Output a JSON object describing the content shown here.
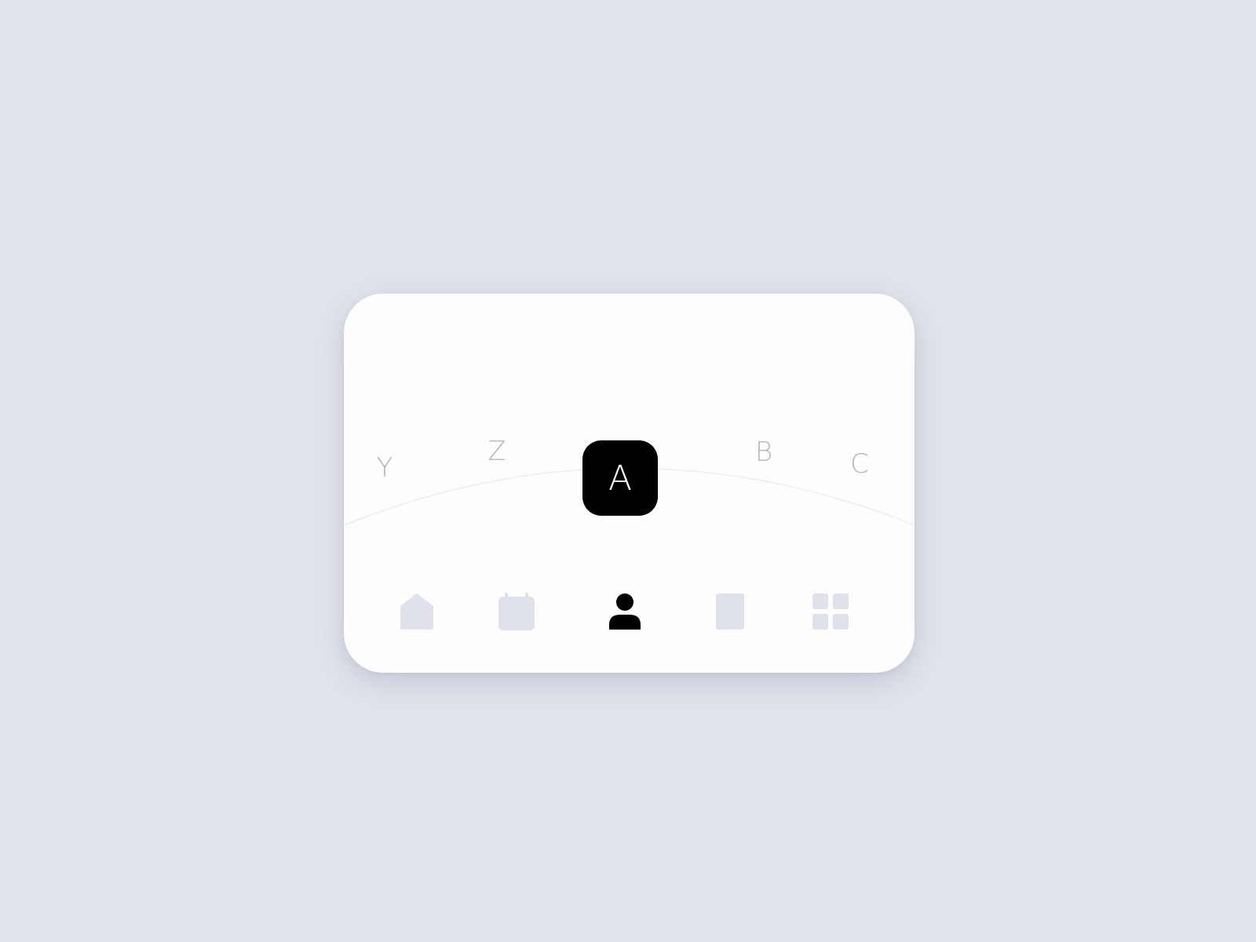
{
  "picker": {
    "letters": {
      "y": "Y",
      "z": "Z",
      "selected": "A",
      "b": "B",
      "c": "C"
    }
  },
  "tabbar": {
    "items": [
      {
        "icon": "home-icon",
        "active": false
      },
      {
        "icon": "calendar-icon",
        "active": false
      },
      {
        "icon": "profile-icon",
        "active": true
      },
      {
        "icon": "book-icon",
        "active": false
      },
      {
        "icon": "grid-icon",
        "active": false
      }
    ]
  },
  "colors": {
    "background": "#e1e4ec",
    "card": "#fdfdfd",
    "active": "#000000",
    "inactive_icon": "#dfe2ea",
    "inactive_letter": "#b3b7c2"
  }
}
